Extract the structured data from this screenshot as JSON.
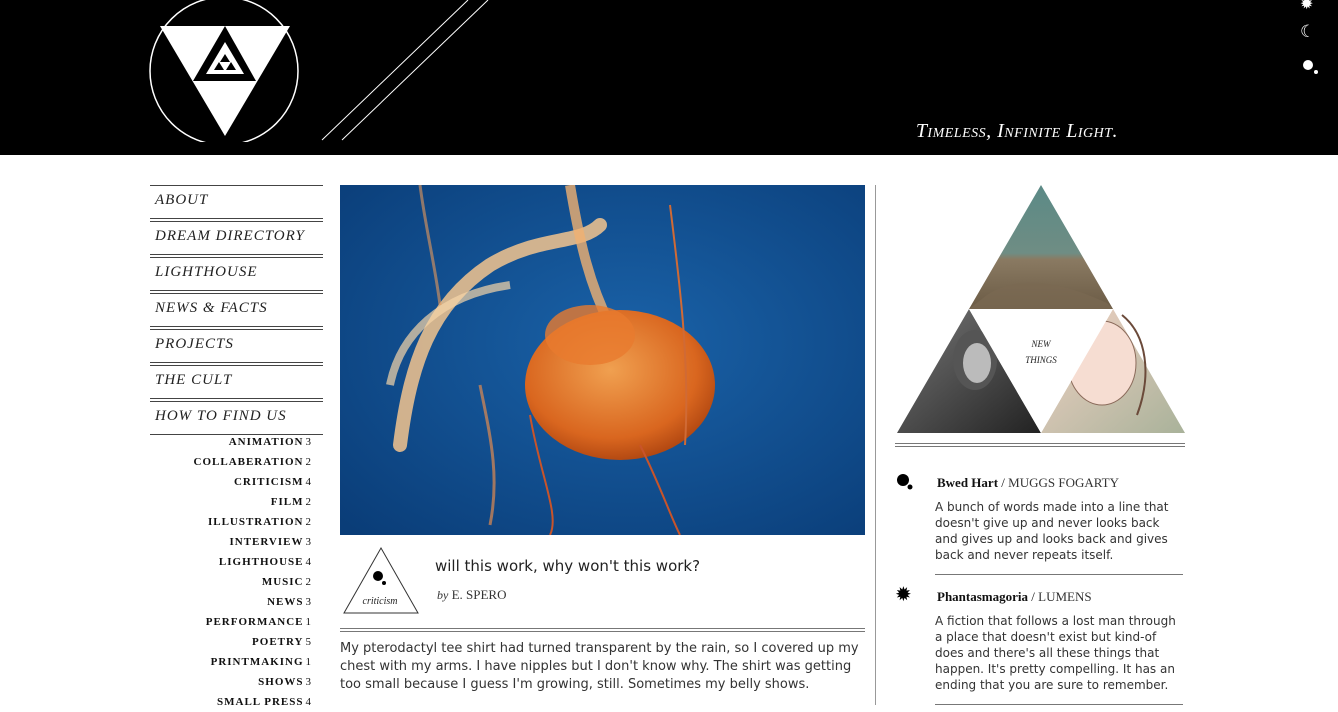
{
  "header": {
    "tagline": "Timeless, Infinite Light.",
    "icons": [
      "sun-icon",
      "moon-icon",
      "dots-icon"
    ]
  },
  "nav": {
    "items": [
      {
        "label": "ABOUT"
      },
      {
        "label": "DREAM DIRECTORY"
      },
      {
        "label": "LIGHTHOUSE"
      },
      {
        "label": "NEWS & FACTS"
      },
      {
        "label": "PROJECTS"
      },
      {
        "label": "THE CULT"
      },
      {
        "label": "HOW TO FIND US"
      }
    ]
  },
  "categories": [
    {
      "name": "ANIMATION",
      "count": "3"
    },
    {
      "name": "COLLABERATION",
      "count": "2"
    },
    {
      "name": "CRITICISM",
      "count": "4"
    },
    {
      "name": "FILM",
      "count": "2"
    },
    {
      "name": "ILLUSTRATION",
      "count": "2"
    },
    {
      "name": "INTERVIEW",
      "count": "3"
    },
    {
      "name": "LIGHTHOUSE",
      "count": "4"
    },
    {
      "name": "MUSIC",
      "count": "2"
    },
    {
      "name": "NEWS",
      "count": "3"
    },
    {
      "name": "PERFORMANCE",
      "count": "1"
    },
    {
      "name": "POETRY",
      "count": "5"
    },
    {
      "name": "PRINTMAKING",
      "count": "1"
    },
    {
      "name": "SHOWS",
      "count": "3"
    },
    {
      "name": "SMALL PRESS",
      "count": "4"
    }
  ],
  "post": {
    "badge_label": "criticism",
    "title": "will this work, why won't this work?",
    "by": "by",
    "author": "E. SPERO",
    "body": "My pterodactyl tee shirt had turned transparent by the rain, so I covered up my chest with my arms. I have nipples but I don't know why. The shirt was getting too small because I guess I'm growing, still. Sometimes my belly shows."
  },
  "sidebar": {
    "feature_label_line1": "NEW",
    "feature_label_line2": "THINGS",
    "entries": [
      {
        "icon": "dots-icon",
        "title": "Bwed Hart",
        "author": "MUGGS FOGARTY",
        "desc": "A bunch of words made into a line that doesn't give up and never looks back and gives up and looks back and gives back and never repeats itself."
      },
      {
        "icon": "sun-icon",
        "title": "Phantasmagoria",
        "author": "LUMENS",
        "desc": "A fiction that follows a lost man through a place that doesn't exist but kind-of does and there's all these things that happen. It's pretty compelling. It has an ending that you are sure to remember."
      }
    ]
  },
  "colors": {
    "header_bg": "#000000",
    "hero_blue": "#0d4f93",
    "jelly_orange": "#d9661f"
  }
}
